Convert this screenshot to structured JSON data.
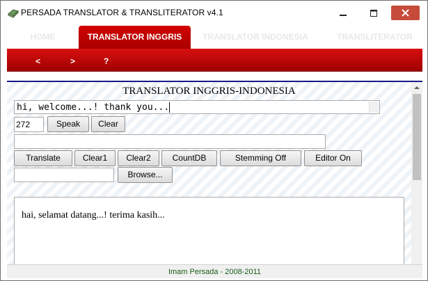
{
  "window": {
    "title": "PERSADA TRANSLATOR & TRANSLITERATOR v4.1",
    "icon": "app-book-icon",
    "minimize_glyph": "—",
    "maximize_glyph": "☐",
    "close_glyph": "✕"
  },
  "tabs": [
    {
      "label": "HOME",
      "active": false
    },
    {
      "label": "TRANSLATOR INGGRIS",
      "active": true
    },
    {
      "label": "TRANSLATOR INDONESIA",
      "active": false
    },
    {
      "label": "TRANSLITERATOR",
      "active": false
    }
  ],
  "nav": {
    "back": "<",
    "forward": ">",
    "help": "?"
  },
  "main": {
    "heading": "TRANSLATOR INGGRIS-INDONESIA",
    "source_text": "hi, welcome...! thank you...",
    "count_value": "272",
    "speak_label": "Speak",
    "clear_label": "Clear",
    "secondary_input": "",
    "buttons": {
      "translate": "Translate",
      "clear1": "Clear1",
      "clear2": "Clear2",
      "countdb": "CountDB",
      "stemming": "Stemming Off",
      "editor": "Editor On"
    },
    "file_input": "",
    "browse_label": "Browse...",
    "result_text": "hai, selamat datang...! terima kasih..."
  },
  "footer": {
    "credit": "Imam Persada - 2008-2011"
  },
  "colors": {
    "accent_red": "#c40000",
    "footer_text": "#1a5c1a",
    "rule_blue": "#1a1a8a"
  }
}
